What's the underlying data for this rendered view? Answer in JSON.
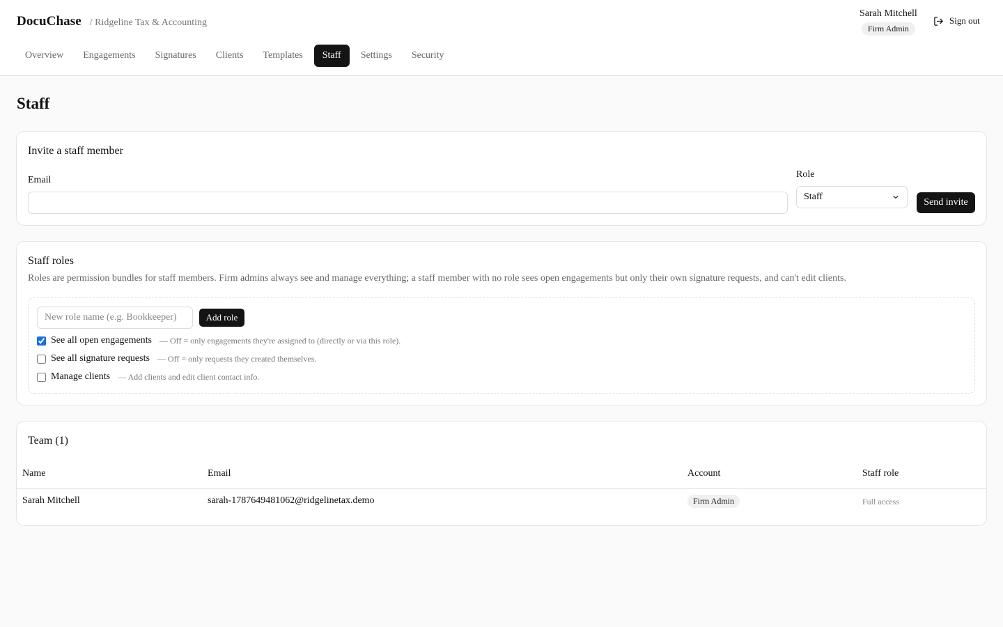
{
  "header": {
    "brand": "DocuChase",
    "firm": "/ Ridgeline Tax & Accounting",
    "user_name": "Sarah Mitchell",
    "user_role": "Firm Admin",
    "signout_label": "Sign out"
  },
  "nav": {
    "tabs": [
      {
        "label": "Overview"
      },
      {
        "label": "Engagements"
      },
      {
        "label": "Signatures"
      },
      {
        "label": "Clients"
      },
      {
        "label": "Templates"
      },
      {
        "label": "Staff",
        "active": true
      },
      {
        "label": "Settings"
      },
      {
        "label": "Security"
      }
    ]
  },
  "page": {
    "title": "Staff"
  },
  "invite": {
    "title": "Invite a staff member",
    "email_label": "Email",
    "email_value": "",
    "role_label": "Role",
    "role_selected": "Staff",
    "send_label": "Send invite"
  },
  "roles": {
    "title": "Staff roles",
    "description": "Roles are permission bundles for staff members. Firm admins always see and manage everything; a staff member with no role sees open engagements but only their own signature requests, and can't edit clients.",
    "new_role_placeholder": "New role name (e.g. Bookkeeper)",
    "add_label": "Add role",
    "permissions": [
      {
        "label": "See all open engagements",
        "hint": "— Off = only engagements they're assigned to (directly or via this role).",
        "checked": true
      },
      {
        "label": "See all signature requests",
        "hint": "— Off = only requests they created themselves.",
        "checked": false
      },
      {
        "label": "Manage clients",
        "hint": "— Add clients and edit client contact info.",
        "checked": false
      }
    ]
  },
  "team": {
    "title": "Team (1)",
    "columns": {
      "name": "Name",
      "email": "Email",
      "account": "Account",
      "staff_role": "Staff role"
    },
    "rows": [
      {
        "name": "Sarah Mitchell",
        "email": "sarah-1787649481062@ridgelinetax.demo",
        "account": "Firm Admin",
        "staff_role": "Full access"
      }
    ]
  },
  "colors": {
    "accent_dark": "#141414",
    "checkbox": "#1a6fe0",
    "page_bg": "#fafafa"
  }
}
